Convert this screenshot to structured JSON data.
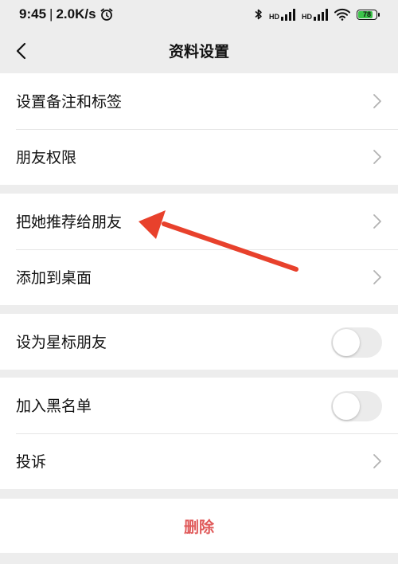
{
  "status_bar": {
    "time": "9:45",
    "separator": "|",
    "net_speed": "2.0K/s",
    "network_1": "HD",
    "network_2": "HD",
    "battery_level": "78",
    "battery_color": "#3cc34a"
  },
  "nav": {
    "back_icon": "chevron-left-icon",
    "title": "资料设置"
  },
  "sections": [
    {
      "items": [
        {
          "label": "设置备注和标签",
          "control": "chevron"
        },
        {
          "label": "朋友权限",
          "control": "chevron"
        }
      ]
    },
    {
      "items": [
        {
          "label": "把她推荐给朋友",
          "control": "chevron"
        },
        {
          "label": "添加到桌面",
          "control": "chevron"
        }
      ]
    },
    {
      "items": [
        {
          "label": "设为星标朋友",
          "control": "toggle",
          "on": false
        }
      ]
    },
    {
      "items": [
        {
          "label": "加入黑名单",
          "control": "toggle",
          "on": false
        },
        {
          "label": "投诉",
          "control": "chevron"
        }
      ]
    }
  ],
  "delete_label": "删除",
  "colors": {
    "delete": "#e05a5a",
    "annotation_arrow": "#e8412c",
    "background": "#ededed"
  }
}
